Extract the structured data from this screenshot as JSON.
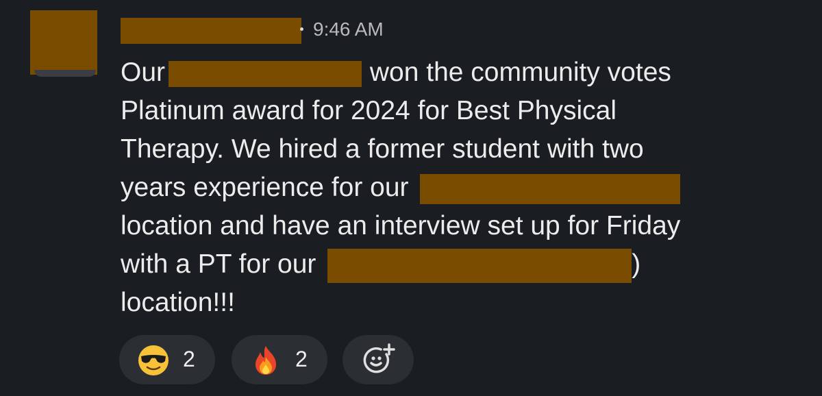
{
  "message": {
    "timestamp": "9:46 AM",
    "lines": [
      {
        "before": "Our ",
        "after": "won the community votes"
      },
      {
        "text": "Platinum award for 2024 for Best Physical"
      },
      {
        "text": "Therapy.  We hired a former student with two"
      },
      {
        "before": "years experience for our "
      },
      {
        "text": "location and have an interview set up for Friday"
      },
      {
        "before": "with a PT for our ",
        "after": ")"
      },
      {
        "text": "location!!!"
      }
    ]
  },
  "reactions": [
    {
      "emoji": "sunglasses-face",
      "count": "2"
    },
    {
      "emoji": "fire",
      "count": "2"
    }
  ],
  "add_reaction": {
    "icon": "add-emoji-icon"
  }
}
